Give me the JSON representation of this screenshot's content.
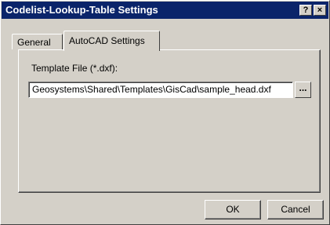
{
  "window": {
    "title": "Codelist-Lookup-Table Settings",
    "help_label": "?",
    "close_label": "×"
  },
  "tabs": [
    {
      "label": "General",
      "active": false
    },
    {
      "label": "AutoCAD Settings",
      "active": true
    }
  ],
  "autocad": {
    "template_label": "Template File (*.dxf):",
    "template_value": "Geosystems\\Shared\\Templates\\GisCad\\sample_head.dxf",
    "browse_label": "..."
  },
  "buttons": {
    "ok": "OK",
    "cancel": "Cancel"
  },
  "colors": {
    "titlebar": "#0a246a",
    "face": "#d4d0c8"
  }
}
